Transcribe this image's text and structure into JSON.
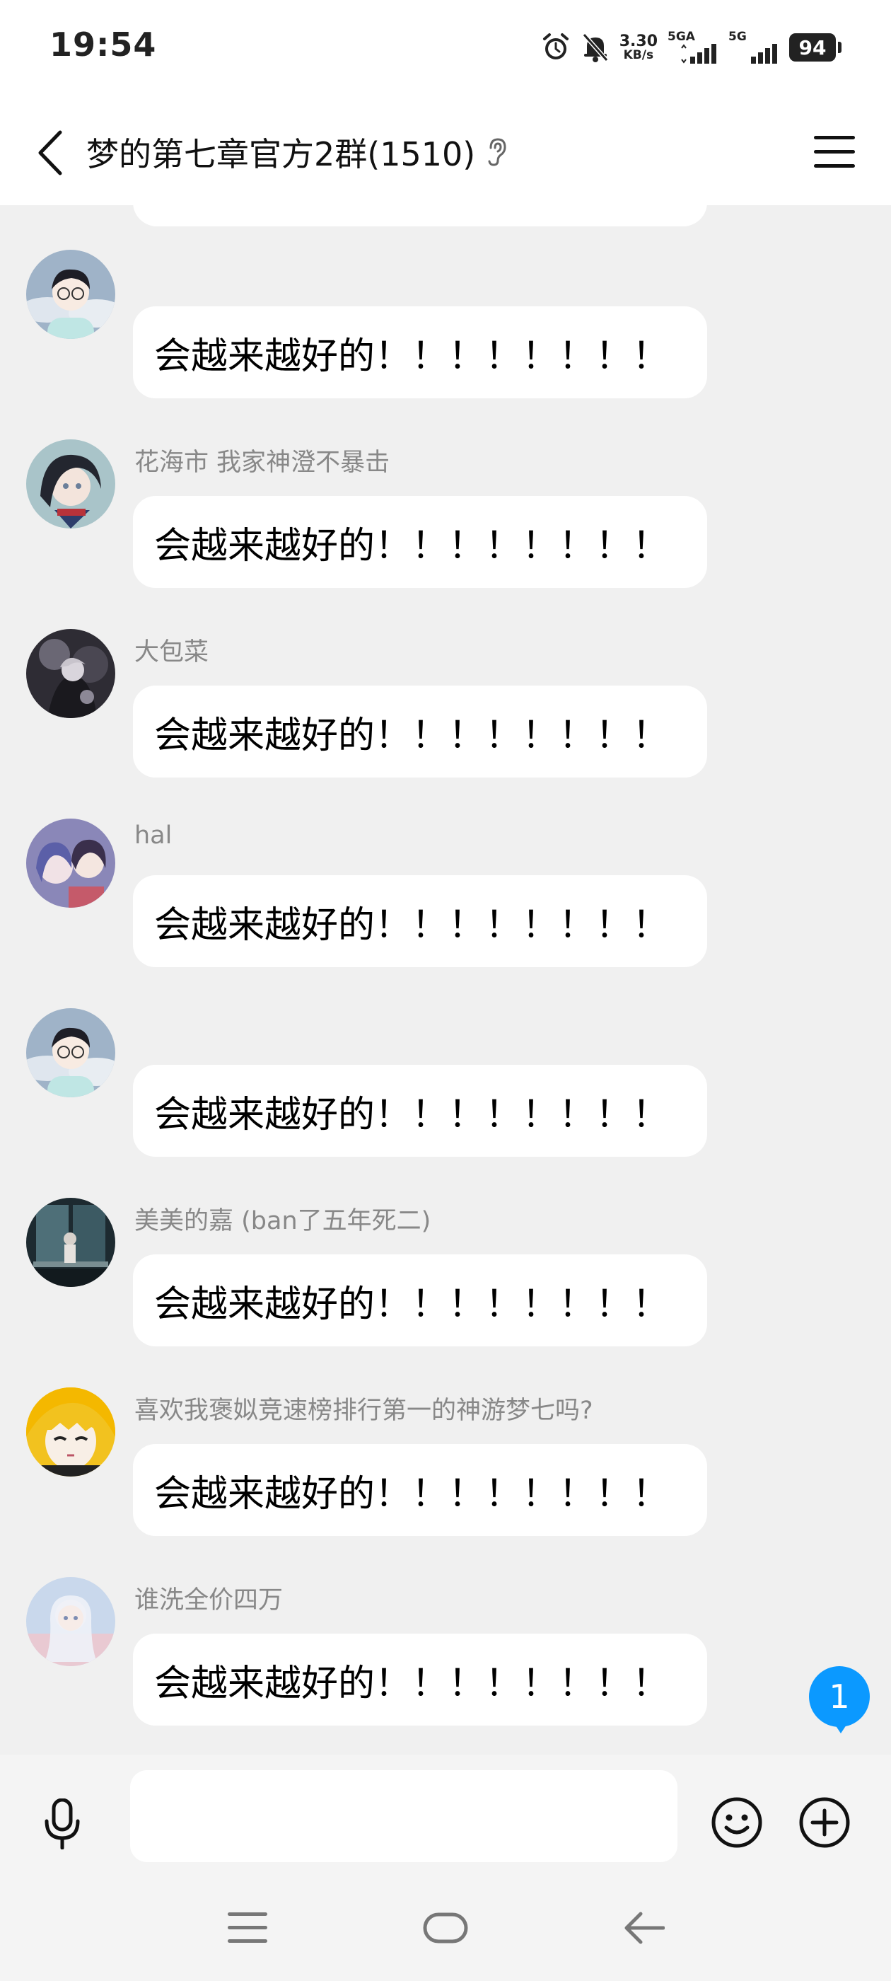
{
  "status_bar": {
    "time": "19:54",
    "net_speed_value": "3.30",
    "net_speed_unit": "KB/s",
    "sim1_label": "5GA",
    "sim2_label": "5G",
    "battery": "94",
    "icons": [
      "alarm-icon",
      "mute-bell-icon",
      "signal-icon",
      "signal-icon"
    ]
  },
  "header": {
    "title": "梦的第七章官方2群(1510)",
    "icons": [
      "back-arrow-icon",
      "ear-icon",
      "hamburger-menu-icon"
    ]
  },
  "messages": [
    {
      "sender": "",
      "text": "会越来越好的！！！！！！！！",
      "avatar": "glasses-boy-avatar"
    },
    {
      "sender": "花海市 我家神澄不暴击",
      "text": "会越来越好的！！！！！！！！",
      "avatar": "anime-dark-hair-avatar"
    },
    {
      "sender": "大包菜",
      "text": "会越来越好的！！！！！！！！",
      "avatar": "dark-figure-avatar"
    },
    {
      "sender": "hal",
      "text": "会越来越好的！！！！！！！！",
      "avatar": "anime-pair-avatar"
    },
    {
      "sender": "",
      "text": "会越来越好的！！！！！！！！",
      "avatar": "glasses-boy-avatar"
    },
    {
      "sender": "美美的嘉 (ban了五年死二)",
      "text": "会越来越好的！！！！！！！！",
      "avatar": "window-scene-avatar"
    },
    {
      "sender": "喜欢我褒姒竞速榜排行第一的神游梦七吗?",
      "text": "会越来越好的！！！！！！！！",
      "avatar": "yellow-hair-anime-avatar"
    },
    {
      "sender": "谁洗全价四万",
      "text": "会越来越好的！！！！！！！！",
      "avatar": "pastel-girl-avatar"
    }
  ],
  "unread_badge": "1",
  "input_bar": {
    "value": "",
    "placeholder": "",
    "icons": [
      "microphone-icon",
      "smiley-icon",
      "plus-icon"
    ]
  },
  "nav_bar": {
    "icons": [
      "nav-menu-icon",
      "nav-home-icon",
      "nav-back-icon"
    ]
  },
  "colors": {
    "accent": "#0b99ff",
    "background": "#f0f0f0",
    "bubble": "#ffffff",
    "sender_text": "#888888"
  }
}
